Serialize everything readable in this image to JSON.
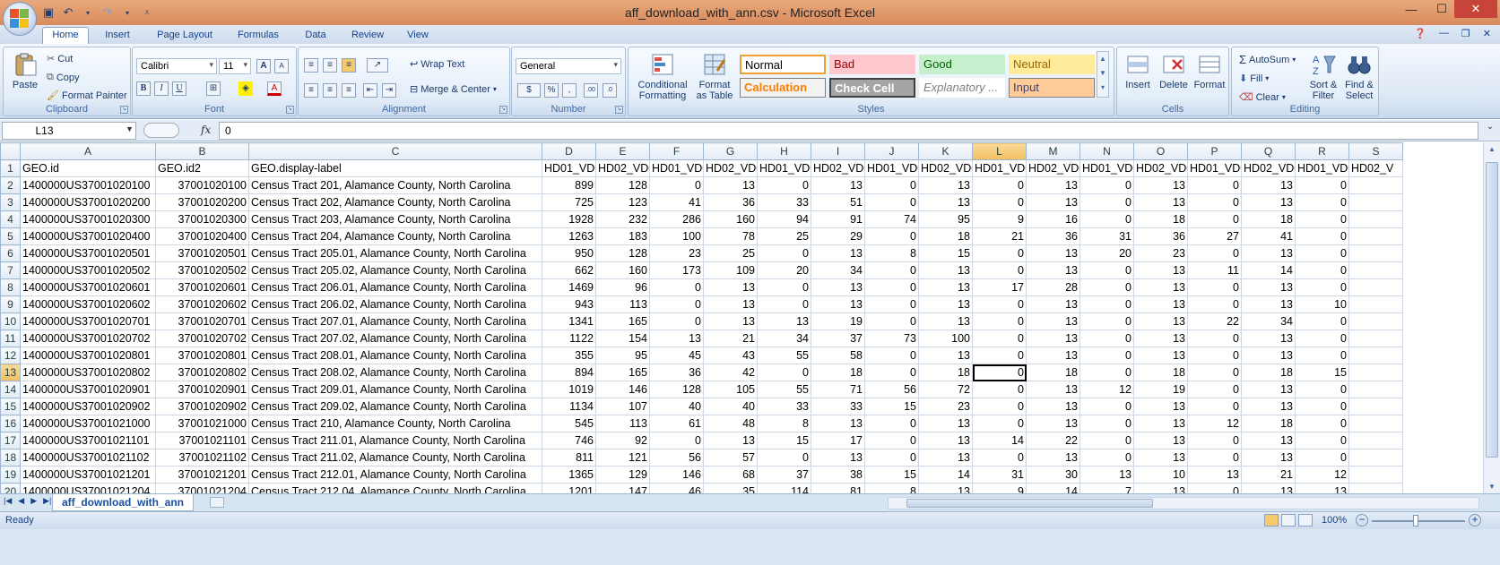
{
  "window": {
    "title": "aff_download_with_ann.csv - Microsoft Excel",
    "minimize": "—",
    "maximize": "☐",
    "close": "✕"
  },
  "quick_access": {
    "save_icon": "save-icon",
    "undo_icon": "undo-icon",
    "redo_icon": "redo-icon"
  },
  "tabs": [
    "Home",
    "Insert",
    "Page Layout",
    "Formulas",
    "Data",
    "Review",
    "View"
  ],
  "active_tab": "Home",
  "ribbon": {
    "clipboard": {
      "label": "Clipboard",
      "paste": "Paste",
      "cut": "Cut",
      "copy": "Copy",
      "format_painter": "Format Painter"
    },
    "font": {
      "label": "Font",
      "font_name": "Calibri",
      "font_size": "11",
      "bold": "B",
      "italic": "I",
      "underline": "U"
    },
    "alignment": {
      "label": "Alignment",
      "wrap_text": "Wrap Text",
      "merge_center": "Merge & Center"
    },
    "number": {
      "label": "Number",
      "format": "General",
      "currency": "$",
      "percent": "%",
      "comma": ","
    },
    "styles": {
      "label": "Styles",
      "conditional_formatting": "Conditional Formatting",
      "format_as_table": "Format as Table",
      "cells": [
        {
          "name": "Normal",
          "bg": "#ffffff",
          "color": "#000000",
          "border": "#f0a030"
        },
        {
          "name": "Bad",
          "bg": "#ffc7ce",
          "color": "#9c0006",
          "border": "#ffc7ce"
        },
        {
          "name": "Good",
          "bg": "#c6efce",
          "color": "#006100",
          "border": "#c6efce"
        },
        {
          "name": "Neutral",
          "bg": "#ffeb9c",
          "color": "#9c6500",
          "border": "#ffeb9c"
        },
        {
          "name": "Calculation",
          "bg": "#f2f2f2",
          "color": "#fa7d00",
          "border": "#7f7f7f"
        },
        {
          "name": "Check Cell",
          "bg": "#a5a5a5",
          "color": "#ffffff",
          "border": "#3f3f3f"
        },
        {
          "name": "Explanatory ...",
          "bg": "#ffffff",
          "color": "#7f7f7f",
          "border": "#ffffff"
        },
        {
          "name": "Input",
          "bg": "#ffcc99",
          "color": "#3f3f76",
          "border": "#7f7f7f"
        }
      ]
    },
    "cells_group": {
      "label": "Cells",
      "insert": "Insert",
      "delete": "Delete",
      "format": "Format"
    },
    "editing": {
      "label": "Editing",
      "autosum": "AutoSum",
      "fill": "Fill",
      "clear": "Clear",
      "sort_filter": "Sort & Filter",
      "find_select": "Find & Select"
    }
  },
  "formula_bar": {
    "name_box": "L13",
    "fx": "fx",
    "value": "0"
  },
  "columns": [
    "A",
    "B",
    "C",
    "D",
    "E",
    "F",
    "G",
    "H",
    "I",
    "J",
    "K",
    "L",
    "M",
    "N",
    "O",
    "P",
    "Q",
    "R",
    "S"
  ],
  "selected_column": "L",
  "selected_row": 13,
  "header_row": [
    "GEO.id",
    "GEO.id2",
    "GEO.display-label",
    "HD01_VD0",
    "HD02_VD0",
    "HD01_VD0",
    "HD02_VD0",
    "HD01_VD0",
    "HD02_VD0",
    "HD01_VD0",
    "HD02_VD0",
    "HD01_VD0",
    "HD02_VD0",
    "HD01_VD0",
    "HD02_VD0",
    "HD01_VD0",
    "HD02_VD0",
    "HD01_VD0",
    "HD02_V"
  ],
  "rows": [
    [
      "1400000US37001020100",
      "37001020100",
      "Census Tract 201, Alamance County, North Carolina",
      "899",
      "128",
      "0",
      "13",
      "0",
      "13",
      "0",
      "13",
      "0",
      "13",
      "0",
      "13",
      "0",
      "13",
      "0",
      ""
    ],
    [
      "1400000US37001020200",
      "37001020200",
      "Census Tract 202, Alamance County, North Carolina",
      "725",
      "123",
      "41",
      "36",
      "33",
      "51",
      "0",
      "13",
      "0",
      "13",
      "0",
      "13",
      "0",
      "13",
      "0",
      ""
    ],
    [
      "1400000US37001020300",
      "37001020300",
      "Census Tract 203, Alamance County, North Carolina",
      "1928",
      "232",
      "286",
      "160",
      "94",
      "91",
      "74",
      "95",
      "9",
      "16",
      "0",
      "18",
      "0",
      "18",
      "0",
      ""
    ],
    [
      "1400000US37001020400",
      "37001020400",
      "Census Tract 204, Alamance County, North Carolina",
      "1263",
      "183",
      "100",
      "78",
      "25",
      "29",
      "0",
      "18",
      "21",
      "36",
      "31",
      "36",
      "27",
      "41",
      "0",
      ""
    ],
    [
      "1400000US37001020501",
      "37001020501",
      "Census Tract 205.01, Alamance County, North Carolina",
      "950",
      "128",
      "23",
      "25",
      "0",
      "13",
      "8",
      "15",
      "0",
      "13",
      "20",
      "23",
      "0",
      "13",
      "0",
      ""
    ],
    [
      "1400000US37001020502",
      "37001020502",
      "Census Tract 205.02, Alamance County, North Carolina",
      "662",
      "160",
      "173",
      "109",
      "20",
      "34",
      "0",
      "13",
      "0",
      "13",
      "0",
      "13",
      "11",
      "14",
      "0",
      ""
    ],
    [
      "1400000US37001020601",
      "37001020601",
      "Census Tract 206.01, Alamance County, North Carolina",
      "1469",
      "96",
      "0",
      "13",
      "0",
      "13",
      "0",
      "13",
      "17",
      "28",
      "0",
      "13",
      "0",
      "13",
      "0",
      ""
    ],
    [
      "1400000US37001020602",
      "37001020602",
      "Census Tract 206.02, Alamance County, North Carolina",
      "943",
      "113",
      "0",
      "13",
      "0",
      "13",
      "0",
      "13",
      "0",
      "13",
      "0",
      "13",
      "0",
      "13",
      "10",
      ""
    ],
    [
      "1400000US37001020701",
      "37001020701",
      "Census Tract 207.01, Alamance County, North Carolina",
      "1341",
      "165",
      "0",
      "13",
      "13",
      "19",
      "0",
      "13",
      "0",
      "13",
      "0",
      "13",
      "22",
      "34",
      "0",
      ""
    ],
    [
      "1400000US37001020702",
      "37001020702",
      "Census Tract 207.02, Alamance County, North Carolina",
      "1122",
      "154",
      "13",
      "21",
      "34",
      "37",
      "73",
      "100",
      "0",
      "13",
      "0",
      "13",
      "0",
      "13",
      "0",
      ""
    ],
    [
      "1400000US37001020801",
      "37001020801",
      "Census Tract 208.01, Alamance County, North Carolina",
      "355",
      "95",
      "45",
      "43",
      "55",
      "58",
      "0",
      "13",
      "0",
      "13",
      "0",
      "13",
      "0",
      "13",
      "0",
      ""
    ],
    [
      "1400000US37001020802",
      "37001020802",
      "Census Tract 208.02, Alamance County, North Carolina",
      "894",
      "165",
      "36",
      "42",
      "0",
      "18",
      "0",
      "18",
      "0",
      "18",
      "0",
      "18",
      "0",
      "18",
      "15",
      ""
    ],
    [
      "1400000US37001020901",
      "37001020901",
      "Census Tract 209.01, Alamance County, North Carolina",
      "1019",
      "146",
      "128",
      "105",
      "55",
      "71",
      "56",
      "72",
      "0",
      "13",
      "12",
      "19",
      "0",
      "13",
      "0",
      ""
    ],
    [
      "1400000US37001020902",
      "37001020902",
      "Census Tract 209.02, Alamance County, North Carolina",
      "1134",
      "107",
      "40",
      "40",
      "33",
      "33",
      "15",
      "23",
      "0",
      "13",
      "0",
      "13",
      "0",
      "13",
      "0",
      ""
    ],
    [
      "1400000US37001021000",
      "37001021000",
      "Census Tract 210, Alamance County, North Carolina",
      "545",
      "113",
      "61",
      "48",
      "8",
      "13",
      "0",
      "13",
      "0",
      "13",
      "0",
      "13",
      "12",
      "18",
      "0",
      ""
    ],
    [
      "1400000US37001021101",
      "37001021101",
      "Census Tract 211.01, Alamance County, North Carolina",
      "746",
      "92",
      "0",
      "13",
      "15",
      "17",
      "0",
      "13",
      "14",
      "22",
      "0",
      "13",
      "0",
      "13",
      "0",
      ""
    ],
    [
      "1400000US37001021102",
      "37001021102",
      "Census Tract 211.02, Alamance County, North Carolina",
      "811",
      "121",
      "56",
      "57",
      "0",
      "13",
      "0",
      "13",
      "0",
      "13",
      "0",
      "13",
      "0",
      "13",
      "0",
      ""
    ],
    [
      "1400000US37001021201",
      "37001021201",
      "Census Tract 212.01, Alamance County, North Carolina",
      "1365",
      "129",
      "146",
      "68",
      "37",
      "38",
      "15",
      "14",
      "31",
      "30",
      "13",
      "10",
      "13",
      "21",
      "12",
      ""
    ],
    [
      "1400000US37001021204",
      "37001021204",
      "Census Tract 212.04, Alamance County, North Carolina",
      "1201",
      "147",
      "46",
      "35",
      "114",
      "81",
      "8",
      "13",
      "9",
      "14",
      "7",
      "13",
      "0",
      "13",
      "13",
      ""
    ]
  ],
  "sheet": {
    "tab_name": "aff_download_with_ann"
  },
  "status": {
    "text": "Ready",
    "zoom": "100%"
  }
}
